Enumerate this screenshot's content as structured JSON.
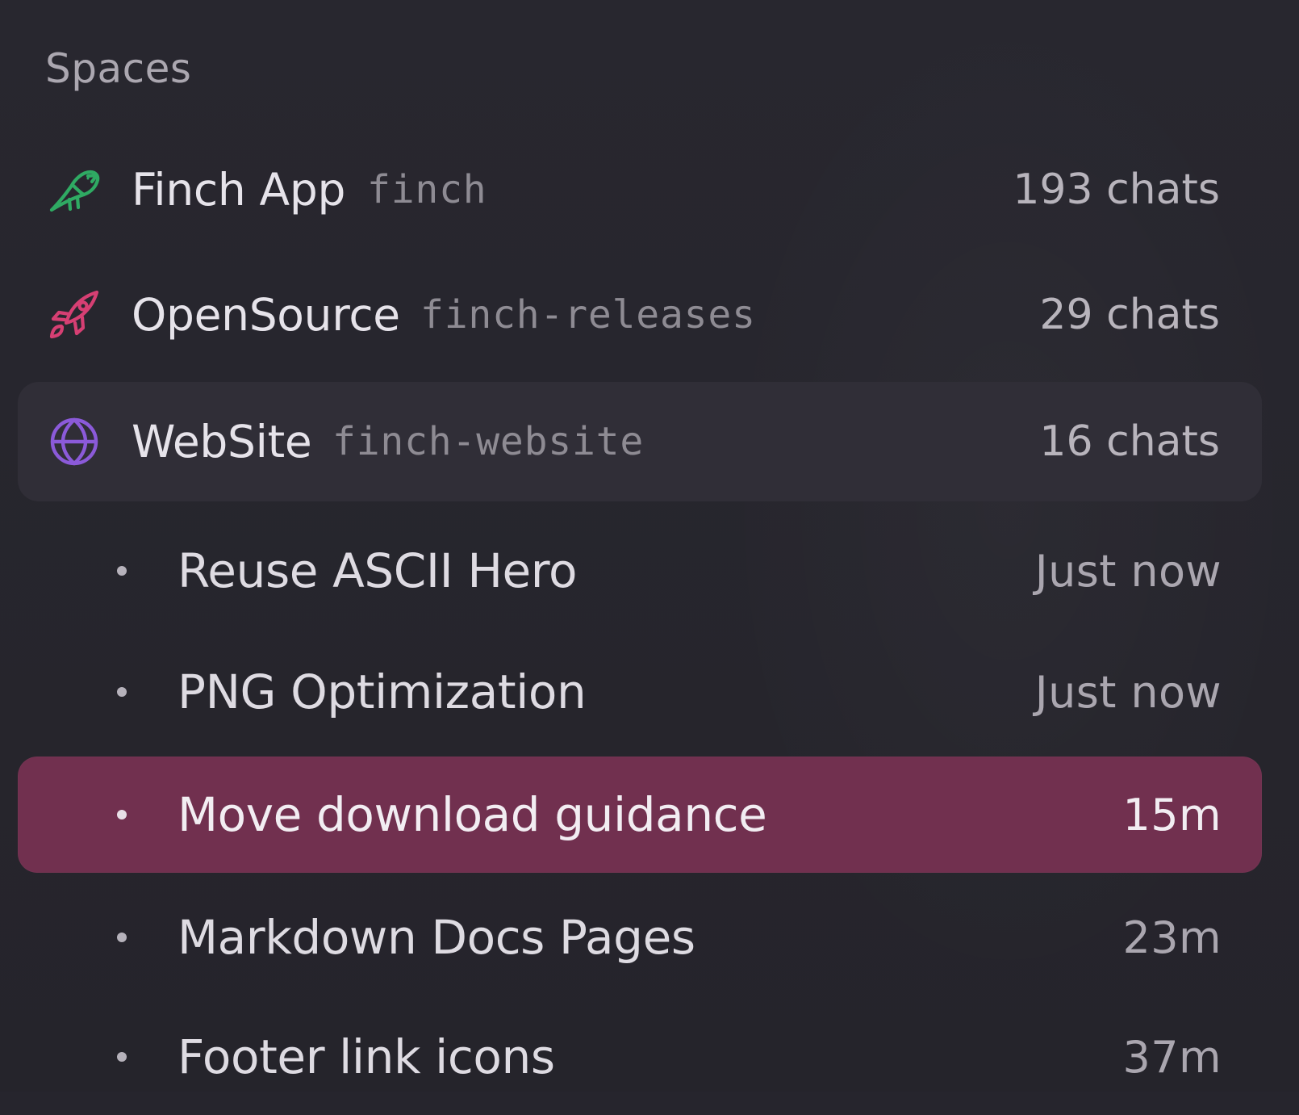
{
  "sidebar": {
    "section_title": "Spaces",
    "spaces": [
      {
        "name": "Finch App",
        "slug": "finch",
        "count": "193 chats",
        "icon": "bird-icon",
        "color": "#2faa63"
      },
      {
        "name": "OpenSource",
        "slug": "finch-releases",
        "count": "29 chats",
        "icon": "rocket-icon",
        "color": "#d63f73"
      },
      {
        "name": "WebSite",
        "slug": "finch-website",
        "count": "16 chats",
        "icon": "globe-icon",
        "color": "#8b5ad9"
      }
    ],
    "chats": [
      {
        "title": "Reuse ASCII Hero",
        "time": "Just now"
      },
      {
        "title": "PNG Optimization",
        "time": "Just now"
      },
      {
        "title": "Move download guidance",
        "time": "15m",
        "active": true
      },
      {
        "title": "Markdown Docs Pages",
        "time": "23m"
      },
      {
        "title": "Footer link icons",
        "time": "37m"
      }
    ]
  },
  "colors": {
    "background": "#26252d",
    "hover_row": "#302e37",
    "active_chat": "#71304f"
  }
}
